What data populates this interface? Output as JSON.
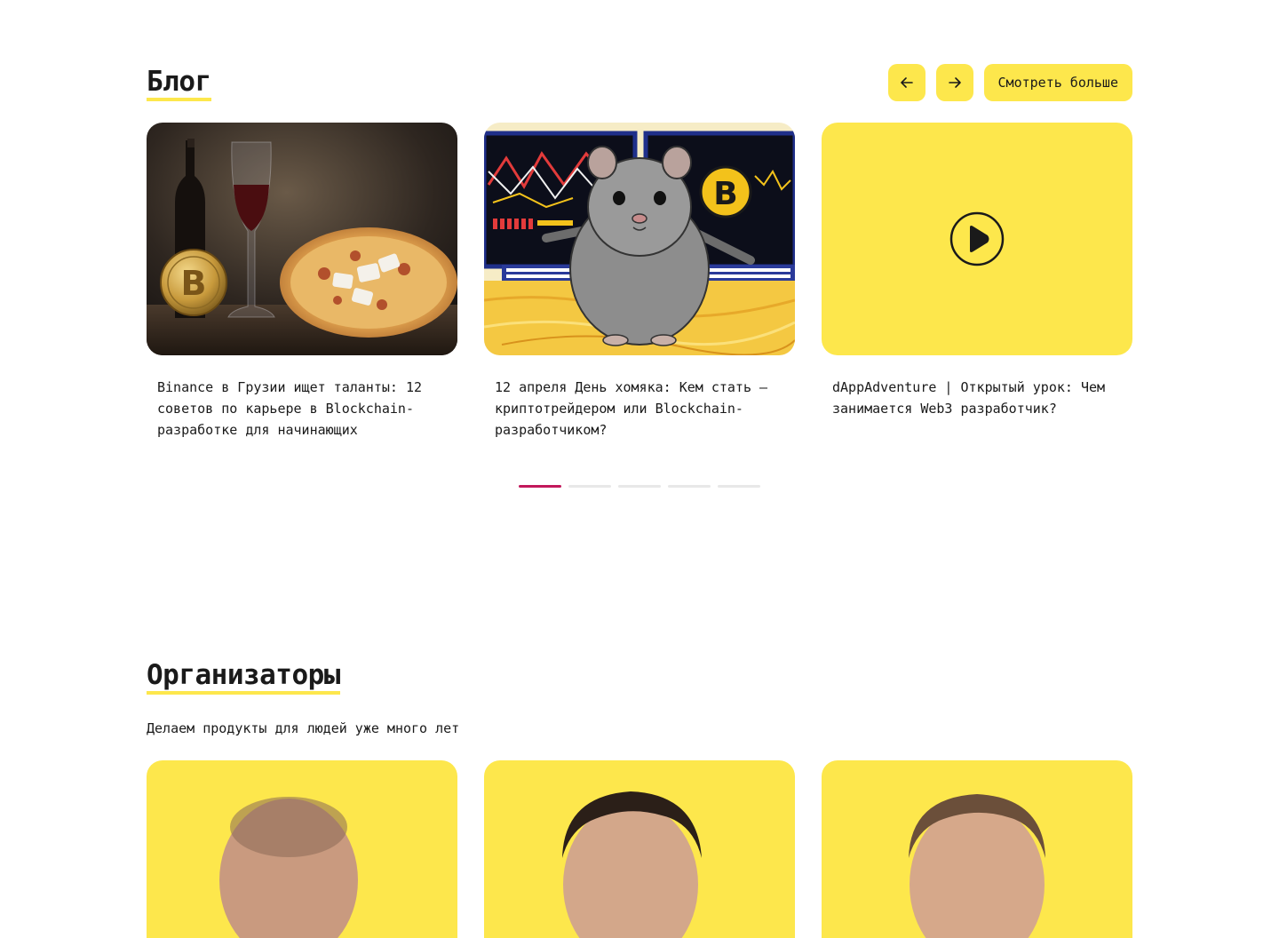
{
  "blog": {
    "title": "Блог",
    "prev_label": "←",
    "next_label": "→",
    "more_label": "Смотреть больше",
    "cards": [
      {
        "title": "Binance в Грузии ищет таланты: 12 советов по карьере в Blockchain-разработке для начинающих",
        "media": "pizza-bitcoin-photo"
      },
      {
        "title": "12 апреля День хомяка: Кем стать — криптотрейдером или Blockchain-разработчиком?",
        "media": "hamster-trader-illustration"
      },
      {
        "title": "dAppAdventure | Открытый урок: Чем занимается Web3 разработчик?",
        "media": "play-icon"
      }
    ],
    "pagination": {
      "total": 5,
      "active": 1
    },
    "coin_symbol": "B"
  },
  "organizers": {
    "title": "Организаторы",
    "subtitle": "Делаем продукты для людей уже много лет",
    "count": 3
  },
  "colors": {
    "accent": "#fde74c",
    "pagination_active": "#c2185b",
    "text": "#1a1a1a"
  }
}
